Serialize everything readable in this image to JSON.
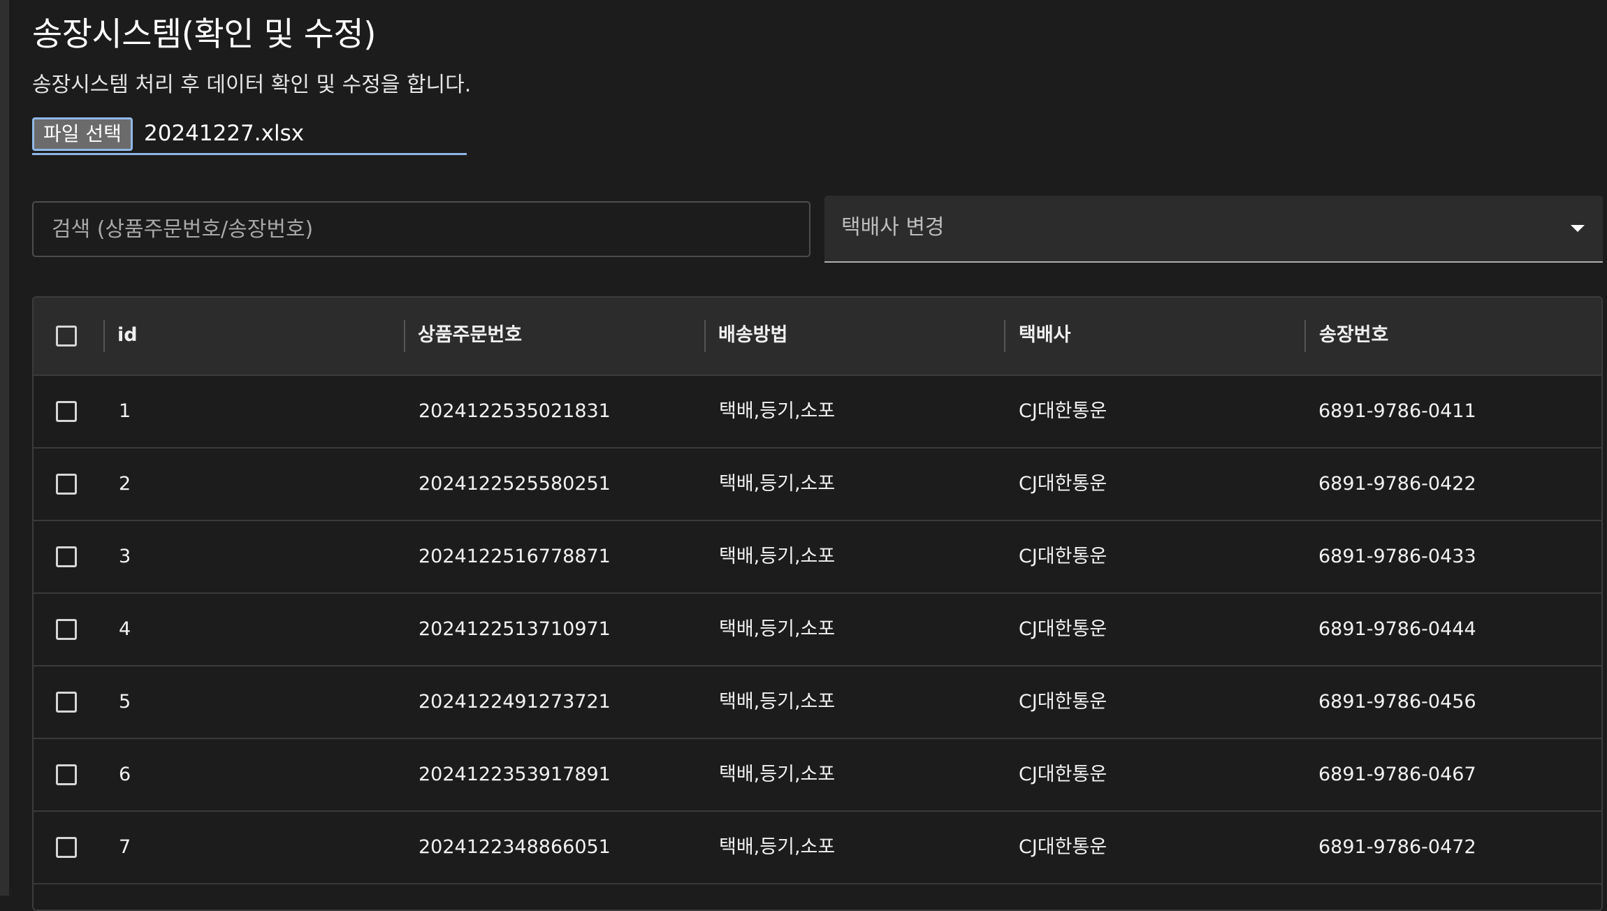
{
  "page": {
    "title": "송장시스템(확인 및 수정)",
    "description": "송장시스템 처리 후 데이터 확인 및 수정을 합니다."
  },
  "file_input": {
    "button_label": "파일 선택",
    "file_name": "20241227.xlsx"
  },
  "search": {
    "placeholder": "검색 (상품주문번호/송장번호)",
    "value": ""
  },
  "carrier_select": {
    "label": "택배사 변경"
  },
  "table": {
    "columns": [
      "id",
      "상품주문번호",
      "배송방법",
      "택배사",
      "송장번호"
    ],
    "rows": [
      {
        "id": "1",
        "order_no": "2024122535021831",
        "method": "택배,등기,소포",
        "carrier": "CJ대한통운",
        "invoice": "6891-9786-0411"
      },
      {
        "id": "2",
        "order_no": "2024122525580251",
        "method": "택배,등기,소포",
        "carrier": "CJ대한통운",
        "invoice": "6891-9786-0422"
      },
      {
        "id": "3",
        "order_no": "2024122516778871",
        "method": "택배,등기,소포",
        "carrier": "CJ대한통운",
        "invoice": "6891-9786-0433"
      },
      {
        "id": "4",
        "order_no": "2024122513710971",
        "method": "택배,등기,소포",
        "carrier": "CJ대한통운",
        "invoice": "6891-9786-0444"
      },
      {
        "id": "5",
        "order_no": "2024122491273721",
        "method": "택배,등기,소포",
        "carrier": "CJ대한통운",
        "invoice": "6891-9786-0456"
      },
      {
        "id": "6",
        "order_no": "2024122353917891",
        "method": "택배,등기,소포",
        "carrier": "CJ대한통운",
        "invoice": "6891-9786-0467"
      },
      {
        "id": "7",
        "order_no": "2024122348866051",
        "method": "택배,등기,소포",
        "carrier": "CJ대한통운",
        "invoice": "6891-9786-0472"
      }
    ]
  },
  "colors": {
    "background": "#1c1c1c",
    "header_background": "#2c2c2c",
    "accent": "#90b8e8",
    "border": "#3c3c3c"
  }
}
